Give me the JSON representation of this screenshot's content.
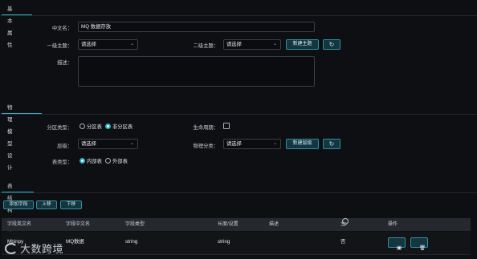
{
  "section1": {
    "tab": "基本属性",
    "chinese_name_label": "中文名：",
    "chinese_name_value": "MQ 数据存放",
    "level1_label": "一级主题：",
    "level1_value": "请选择",
    "level2_label": "二级主题：",
    "level2_value": "请选择",
    "new_theme_button": "新建主题",
    "description_label": "描述："
  },
  "section2": {
    "tab": "物理模型设计",
    "partition_type_label": "分区类型：",
    "partition_option": "分区表",
    "non_partition_option": "非分区表",
    "lifecycle_label": "生命周期：",
    "layer_label": "层级：",
    "layer_value": "请选择",
    "phys_category_label": "物理分类：",
    "phys_category_value": "请选择",
    "new_layer_button": "新建层级",
    "table_type_label": "表类型：",
    "internal_option": "内部表",
    "external_option": "外部表"
  },
  "section3": {
    "tab": "表结构设计",
    "add_field_button": "添加字段",
    "move_up_button": "上移",
    "move_down_button": "下移",
    "columns": [
      "字段英文名",
      "字段中文名",
      "字段类型",
      "长度/设置",
      "描述",
      "主键",
      "操作"
    ],
    "rows": [
      {
        "en_name": "Mbinpy",
        "cn_name": "MQ数据",
        "type": "string",
        "length": "string",
        "desc": "",
        "pk": "否"
      }
    ]
  },
  "watermark": "大数跨境",
  "icons": {
    "refresh": "refresh-icon",
    "dropdown": "chevron-down-icon",
    "help": "help-circle-icon",
    "save": "save-icon",
    "delete": "trash-icon"
  },
  "colors": {
    "accent": "#27b3c8",
    "background": "#0e0f12"
  }
}
